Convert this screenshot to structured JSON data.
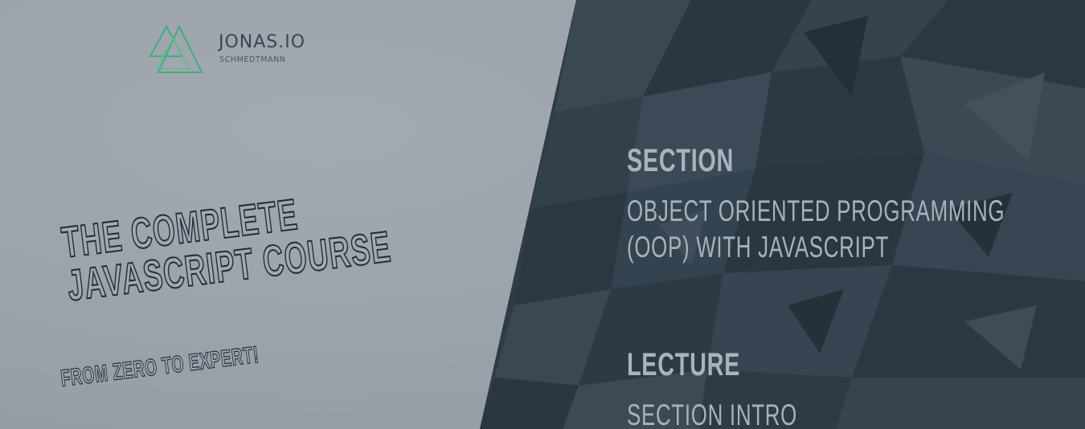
{
  "logo": {
    "name": "JONAS.IO",
    "subtitle": "SCHMEDTMANN",
    "accent_color": "#3fae7a"
  },
  "course": {
    "title_line1": "THE COMPLETE",
    "title_line2": "JAVASCRIPT COURSE",
    "subtitle": "FROM ZERO TO EXPERT!"
  },
  "section": {
    "heading": "SECTION",
    "text_line1": "OBJECT ORIENTED PROGRAMMING",
    "text_line2": "(OOP) WITH JAVASCRIPT"
  },
  "lecture": {
    "heading": "LECTURE",
    "text": "SECTION INTRO"
  },
  "colors": {
    "left_background": "#9ba1a9",
    "right_background": "#2f3d48",
    "title_outline": "#202b34",
    "right_text": "#aab3bb"
  }
}
